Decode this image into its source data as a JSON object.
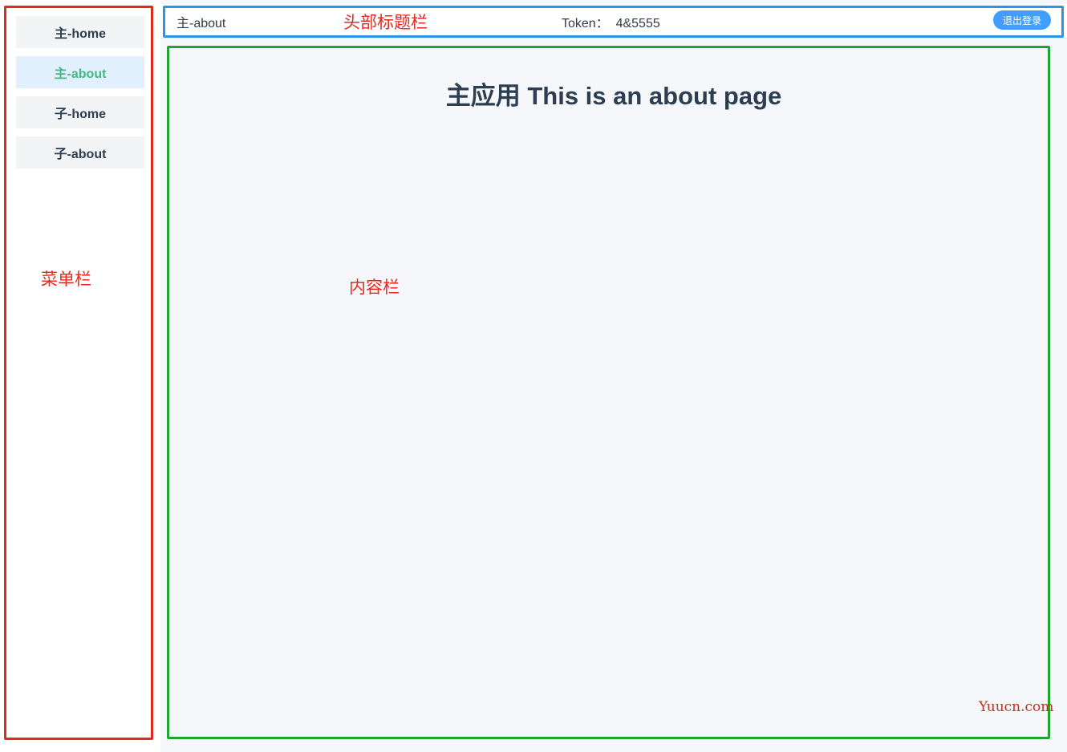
{
  "sidebar": {
    "items": [
      {
        "label": "主-home"
      },
      {
        "label": "主-about"
      },
      {
        "label": "子-home"
      },
      {
        "label": "子-about"
      }
    ],
    "active_index": 1
  },
  "header": {
    "title": "主-about",
    "token": "Token：  4&5555",
    "logout_label": "退出登录"
  },
  "content": {
    "heading": "主应用 This is an about page"
  },
  "annotations": {
    "header_label": "头部标题栏",
    "menu_label": "菜单栏",
    "content_label": "内容栏"
  },
  "watermark": "Yuucn.com",
  "colors": {
    "active_text": "#42b983",
    "active_bg": "#e2f0fd",
    "logout_bg": "#409eff",
    "menu_box": "#e02a1f",
    "header_box": "#2d95e5",
    "content_box": "#22a52e",
    "annotation_text": "#e52a1e"
  }
}
